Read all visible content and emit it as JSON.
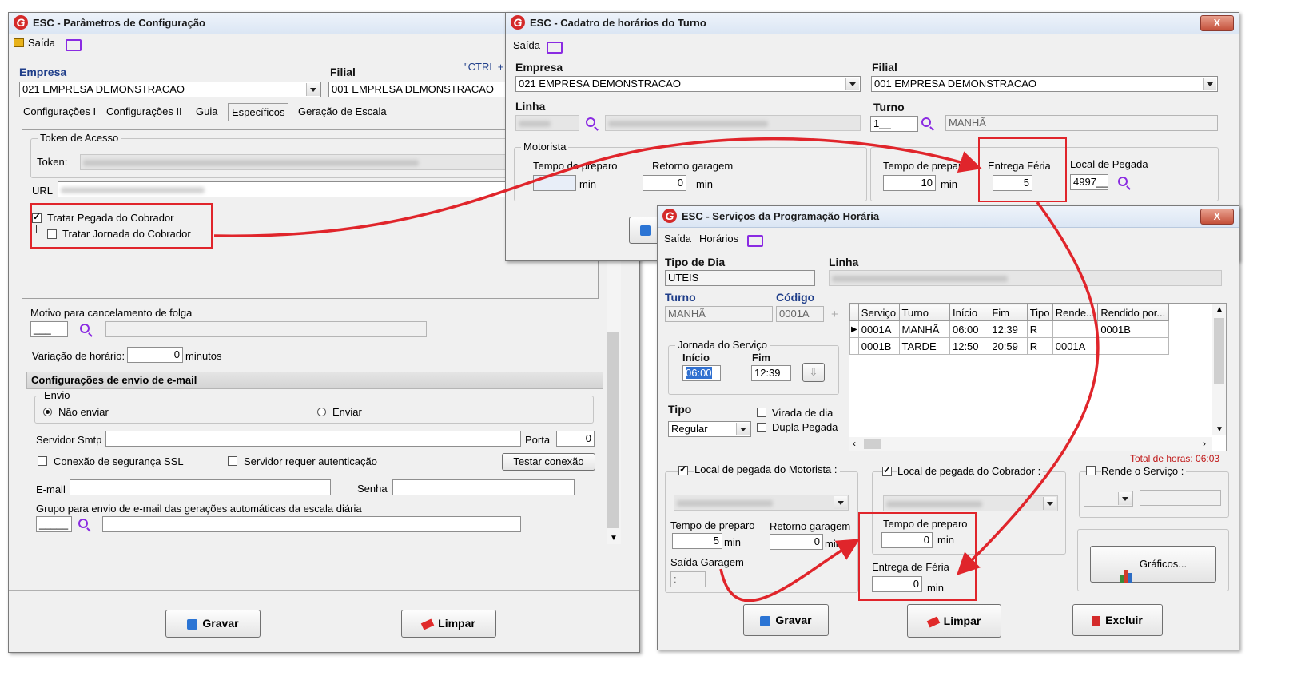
{
  "win1": {
    "title": "ESC - Parâmetros de Configuração",
    "menu_saida": "Saída",
    "empresa_label": "Empresa",
    "empresa_value": "021 EMPRESA DEMONSTRACAO",
    "filial_label": "Filial",
    "filial_value": "001 EMPRESA DEMONSTRACAO",
    "ctrl_hint": "\"CTRL +",
    "tabs": [
      "Configurações I",
      "Configurações II",
      "Guia",
      "Específicos",
      "Geração de Escala"
    ],
    "token_group": "Token de Acesso",
    "token_label": "Token:",
    "url_label": "URL",
    "tratar_pegada": "Tratar  Pegada do Cobrador",
    "tratar_jornada": "Tratar  Jornada do Cobrador",
    "motivo_label": "Motivo para cancelamento de folga",
    "motivo_code": "___",
    "variacao_label": "Variação de horário:",
    "variacao_value": "0",
    "variacao_unit": "minutos",
    "email_section": "Configurações de envio de e-mail",
    "envio_group": "Envio",
    "nao_enviar": "Não enviar",
    "enviar": "Enviar",
    "servidor_label": "Servidor Smtp",
    "porta_label": "Porta",
    "porta_value": "0",
    "ssl_label": "Conexão de segurança SSL",
    "auth_label": "Servidor requer autenticação",
    "testar_btn": "Testar conexão",
    "email_label": "E-mail",
    "senha_label": "Senha",
    "grupo_label": "Grupo para envio de e-mail das gerações automáticas da escala diária",
    "grupo_code": "_____",
    "gravar_btn": "Gravar",
    "limpar_btn": "Limpar"
  },
  "win2": {
    "title": "ESC - Cadatro de horários do Turno",
    "menu_saida": "Saída",
    "close": "X",
    "empresa_label": "Empresa",
    "empresa_value": "021 EMPRESA DEMONSTRACAO",
    "filial_label": "Filial",
    "filial_value": "001 EMPRESA DEMONSTRACAO",
    "linha_label": "Linha",
    "turno_label": "Turno",
    "turno_code": "1__",
    "turno_name": "MANHÃ",
    "motorista_group": "Motorista",
    "tempo_preparo": "Tempo de preparo",
    "retorno_garagem": "Retorno garagem",
    "motorista_retorno_value": "0",
    "min": "min",
    "cobrador_tempo_value": "10",
    "entrega_feria_label": "Entrega Féria",
    "entrega_feria_value": "5",
    "local_pegada_label": "Local de Pegada",
    "local_pegada_value": "4997__"
  },
  "win3": {
    "title": "ESC - Serviços da Programação Horária",
    "close": "X",
    "menu_saida": "Saída",
    "menu_horarios": "Horários",
    "tipo_dia_label": "Tipo de Dia",
    "tipo_dia_value": "UTEIS",
    "linha_label": "Linha",
    "turno_label": "Turno",
    "turno_value": "MANHÃ",
    "codigo_label": "Código",
    "codigo_value": "0001A",
    "jornada_group": "Jornada do Serviço",
    "inicio_label": "Início",
    "inicio_value": "06:00",
    "fim_label": "Fim",
    "fim_value": "12:39",
    "tipo_label": "Tipo",
    "tipo_value": "Regular",
    "virada_dia": "Virada de dia",
    "dupla_pegada": "Dupla Pegada",
    "grid_headers": [
      "Serviço",
      "Turno",
      "Início",
      "Fim",
      "Tipo",
      "Rende...",
      "Rendido por..."
    ],
    "grid_rows": [
      [
        "0001A",
        "MANHÃ",
        "06:00",
        "12:39",
        "R",
        "",
        "0001B"
      ],
      [
        "0001B",
        "TARDE",
        "12:50",
        "20:59",
        "R",
        "0001A",
        ""
      ]
    ],
    "total_horas": "Total de horas: 06:03",
    "local_motorista": "Local de pegada do Motorista :",
    "local_cobrador": "Local de pegada do Cobrador :",
    "rende_servico": "Rende o Serviço :",
    "tempo_preparo": "Tempo de preparo",
    "tempo_preparo_mot_value": "5",
    "retorno_garagem": "Retorno garagem",
    "retorno_garagem_value": "0",
    "min": "min",
    "saida_garagem": "Saída Garagem",
    "saida_garagem_value": ":",
    "tempo_preparo_cob_value": "0",
    "entrega_feria_label": "Entrega de Féria",
    "entrega_feria_value": "0",
    "graficos_btn": "Gráficos...",
    "gravar_btn": "Gravar",
    "limpar_btn": "Limpar",
    "excluir_btn": "Excluir"
  }
}
